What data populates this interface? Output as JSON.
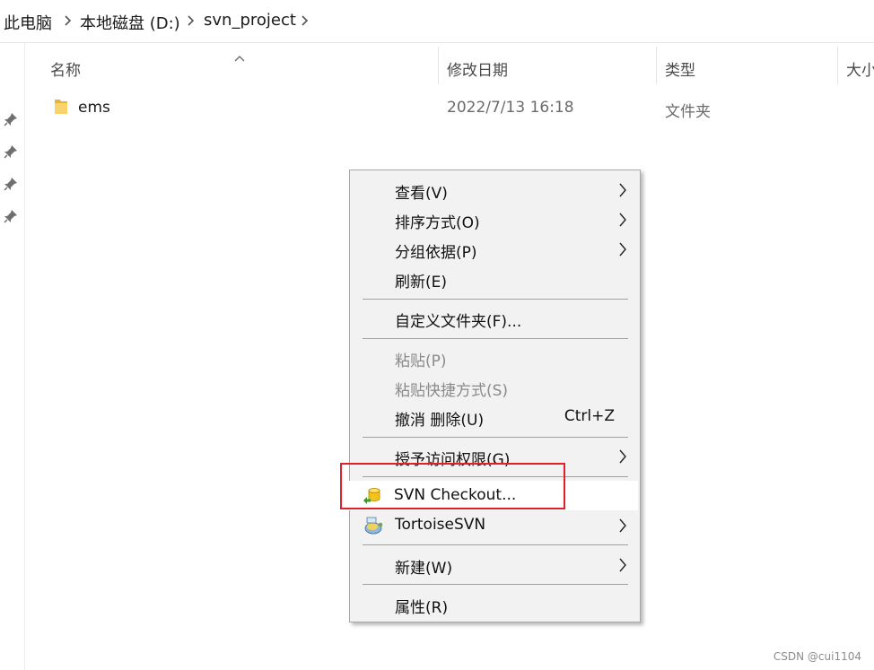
{
  "breadcrumb": {
    "items": [
      "此电脑",
      "本地磁盘 (D:)",
      "svn_project"
    ]
  },
  "columns": {
    "name": "名称",
    "modified": "修改日期",
    "type": "类型",
    "size": "大小"
  },
  "files": [
    {
      "name": "ems",
      "modified": "2022/7/13 16:18",
      "type": "文件夹",
      "icon": "folder-icon"
    }
  ],
  "context_menu": {
    "items": [
      {
        "label": "查看(V)",
        "submenu": true
      },
      {
        "label": "排序方式(O)",
        "submenu": true
      },
      {
        "label": "分组依据(P)",
        "submenu": true
      },
      {
        "label": "刷新(E)"
      },
      {
        "label": "自定义文件夹(F)..."
      },
      {
        "label": "粘贴(P)",
        "disabled": true
      },
      {
        "label": "粘贴快捷方式(S)",
        "disabled": true
      },
      {
        "label": "撤消 删除(U)",
        "shortcut": "Ctrl+Z"
      },
      {
        "label": "授予访问权限(G)",
        "submenu": true
      },
      {
        "label": "SVN Checkout...",
        "icon": "svn-checkout-icon",
        "hovered": true
      },
      {
        "label": "TortoiseSVN",
        "icon": "tortoisesvn-icon",
        "submenu": true
      },
      {
        "label": "新建(W)",
        "submenu": true
      },
      {
        "label": "属性(R)"
      }
    ]
  },
  "colors": {
    "highlight": "#e0202a",
    "menu_bg": "#f2f2f2",
    "folder": "#f6c64e"
  },
  "watermark": "CSDN @cui1104"
}
